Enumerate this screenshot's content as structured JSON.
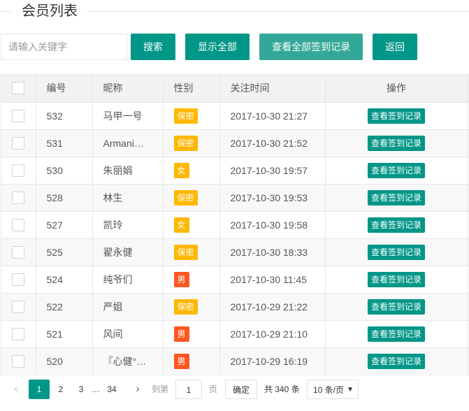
{
  "legend": {
    "title": "会员列表"
  },
  "toolbar": {
    "search_placeholder": "请输入关键字",
    "search_label": "搜索",
    "show_all_label": "显示全部",
    "all_checkin_label": "查看全部签到记录",
    "back_label": "返回"
  },
  "table": {
    "headers": {
      "id": "编号",
      "nickname": "昵称",
      "gender": "性别",
      "follow_time": "关注时间",
      "action": "操作"
    },
    "rows": [
      {
        "id": "532",
        "nickname": "马甲一号",
        "gender": "保密",
        "gender_type": "secret",
        "follow_time": "2017-10-30 21:27",
        "action": "查看签到记录"
      },
      {
        "id": "531",
        "nickname": "Armani…",
        "gender": "保密",
        "gender_type": "secret",
        "follow_time": "2017-10-30 21:52",
        "action": "查看签到记录"
      },
      {
        "id": "530",
        "nickname": "朱丽娟",
        "gender": "女",
        "gender_type": "female",
        "follow_time": "2017-10-30 19:57",
        "action": "查看签到记录"
      },
      {
        "id": "528",
        "nickname": "林生",
        "gender": "保密",
        "gender_type": "secret",
        "follow_time": "2017-10-30 19:53",
        "action": "查看签到记录"
      },
      {
        "id": "527",
        "nickname": "凯玲",
        "gender": "女",
        "gender_type": "female",
        "follow_time": "2017-10-30 19:58",
        "action": "查看签到记录"
      },
      {
        "id": "525",
        "nickname": "翟永健",
        "gender": "保密",
        "gender_type": "secret",
        "follow_time": "2017-10-30 18:33",
        "action": "查看签到记录"
      },
      {
        "id": "524",
        "nickname": "纯爷们",
        "gender": "男",
        "gender_type": "male",
        "follow_time": "2017-10-30 11:45",
        "action": "查看签到记录"
      },
      {
        "id": "522",
        "nickname": "严姐",
        "gender": "保密",
        "gender_type": "secret",
        "follow_time": "2017-10-29 21:22",
        "action": "查看签到记录"
      },
      {
        "id": "521",
        "nickname": "风间",
        "gender": "男",
        "gender_type": "male",
        "follow_time": "2017-10-29 21:10",
        "action": "查看签到记录"
      },
      {
        "id": "520",
        "nickname": "『心健°…",
        "gender": "男",
        "gender_type": "male",
        "follow_time": "2017-10-29 16:19",
        "action": "查看签到记录"
      }
    ]
  },
  "pager": {
    "prev_icon": "chevron-left-icon",
    "next_icon": "chevron-right-icon",
    "pages": [
      "1",
      "2",
      "3"
    ],
    "ellipsis": "…",
    "last_page": "34",
    "current_page": "1",
    "goto_label": "到第",
    "goto_value": "1",
    "page_label": "页",
    "confirm_label": "确定",
    "total_label": "共 340 条",
    "limit_label": "10 条/页"
  },
  "colors": {
    "primary": "#009688",
    "secret": "#ffb800",
    "male": "#ff5722"
  }
}
